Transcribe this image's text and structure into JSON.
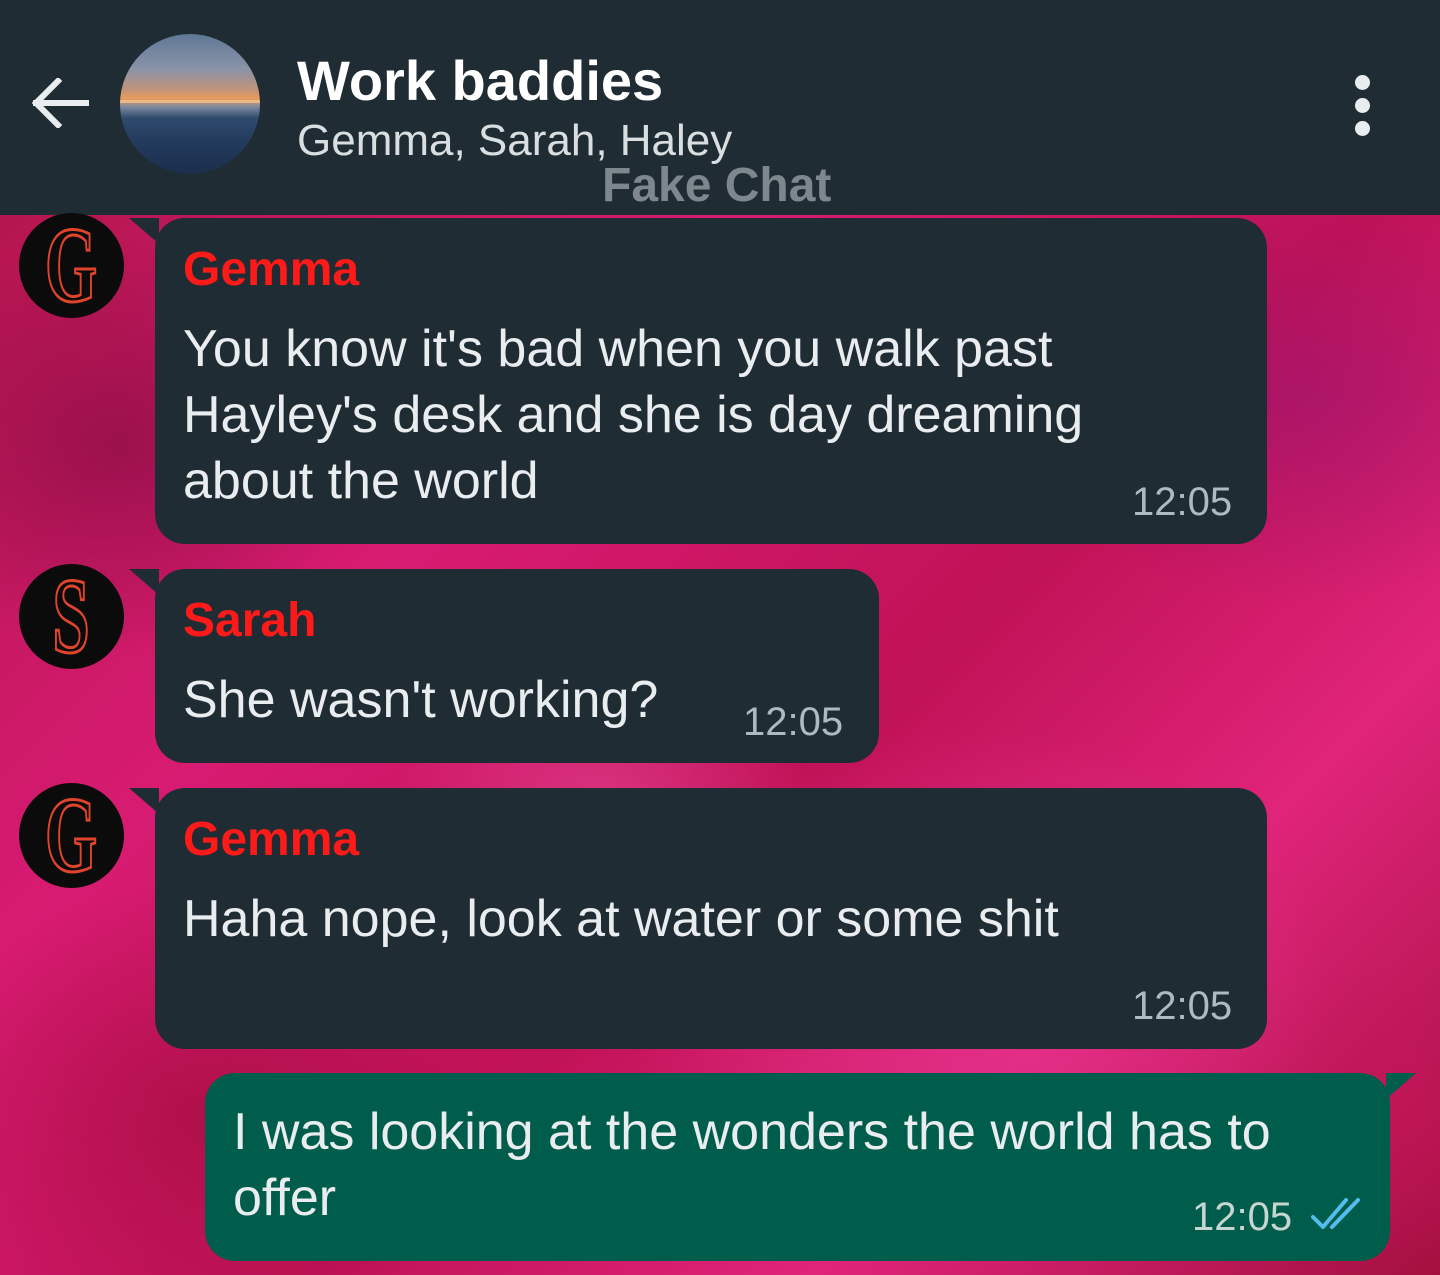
{
  "header": {
    "title": "Work baddies",
    "participants": "Gemma, Sarah, Haley",
    "watermark": "Fake Chat"
  },
  "messages": [
    {
      "direction": "incoming",
      "sender": "Gemma",
      "avatar_letter": "G",
      "text": "You know it's bad when you walk past Hayley's desk and she is day dreaming about the world",
      "time": "12:05"
    },
    {
      "direction": "incoming",
      "sender": "Sarah",
      "avatar_letter": "S",
      "text": "She wasn't working?",
      "time": "12:05"
    },
    {
      "direction": "incoming",
      "sender": "Gemma",
      "avatar_letter": "G",
      "text": "Haha nope, look at water or some shit",
      "time": "12:05"
    },
    {
      "direction": "outgoing",
      "text": "I was looking at the wonders the world has to offer",
      "time": "12:05",
      "status": "read"
    }
  ],
  "colors": {
    "header_bg": "#202c33",
    "incoming_bubble": "#202c33",
    "outgoing_bubble": "#005c4b",
    "sender_name": "#ff1a1a",
    "read_ticks": "#53bdeb",
    "wallpaper": "#c2185b"
  },
  "icons": {
    "back": "arrow-left-icon",
    "menu": "more-vertical-icon",
    "status": "double-check-icon"
  }
}
